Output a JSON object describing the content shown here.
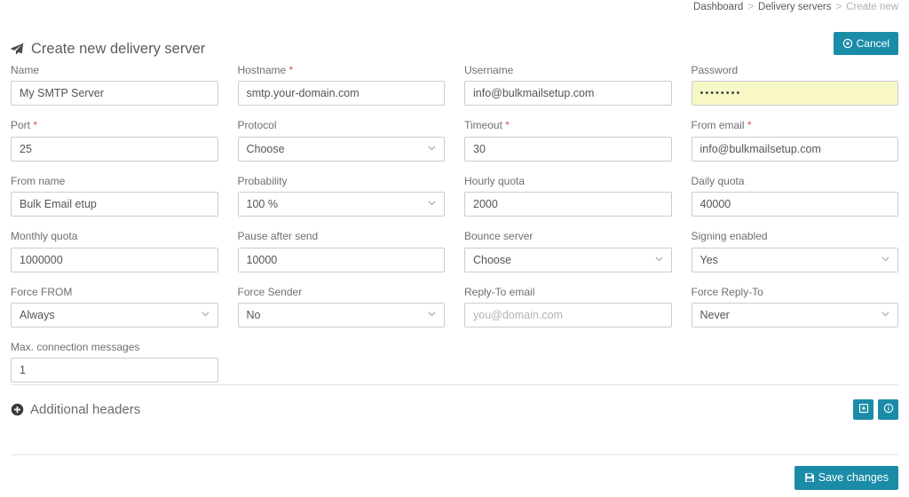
{
  "breadcrumb": {
    "items": [
      {
        "label": "Dashboard",
        "current": false
      },
      {
        "label": "Delivery servers",
        "current": false
      },
      {
        "label": "Create new",
        "current": true
      }
    ],
    "separator": ">"
  },
  "header": {
    "title": "Create new delivery server",
    "title_icon": "paper-plane-icon",
    "cancel_label": "Cancel",
    "cancel_icon": "ban-circle-icon"
  },
  "theme": {
    "accent": "#1b8ca8",
    "autofill_yellow": "#f7f8c6",
    "required_star": "#d9534f",
    "label_gray": "#6f6f6f",
    "border_gray": "#cccccc"
  },
  "form": {
    "fields": [
      {
        "label": "Name",
        "required": false,
        "type": "text",
        "value": "My SMTP Server",
        "placeholder": ""
      },
      {
        "label": "Hostname",
        "required": true,
        "type": "text",
        "value": "smtp.your-domain.com",
        "placeholder": ""
      },
      {
        "label": "Username",
        "required": false,
        "type": "text",
        "value": "info@bulkmailsetup.com",
        "placeholder": ""
      },
      {
        "label": "Password",
        "required": false,
        "type": "password",
        "value": "••••••••",
        "placeholder": "",
        "autofill": true
      },
      {
        "label": "Port",
        "required": true,
        "type": "text",
        "value": "25",
        "placeholder": ""
      },
      {
        "label": "Protocol",
        "required": false,
        "type": "select",
        "value": "Choose",
        "placeholder": ""
      },
      {
        "label": "Timeout",
        "required": true,
        "type": "text",
        "value": "30",
        "placeholder": ""
      },
      {
        "label": "From email",
        "required": true,
        "type": "text",
        "value": "info@bulkmailsetup.com",
        "placeholder": ""
      },
      {
        "label": "From name",
        "required": false,
        "type": "text",
        "value": "Bulk Email etup",
        "placeholder": ""
      },
      {
        "label": "Probability",
        "required": false,
        "type": "select",
        "value": "100 %",
        "placeholder": ""
      },
      {
        "label": "Hourly quota",
        "required": false,
        "type": "text",
        "value": "2000",
        "placeholder": ""
      },
      {
        "label": "Daily quota",
        "required": false,
        "type": "text",
        "value": "40000",
        "placeholder": ""
      },
      {
        "label": "Monthly quota",
        "required": false,
        "type": "text",
        "value": "1000000",
        "placeholder": ""
      },
      {
        "label": "Pause after send",
        "required": false,
        "type": "text",
        "value": "10000",
        "placeholder": ""
      },
      {
        "label": "Bounce server",
        "required": false,
        "type": "select",
        "value": "Choose",
        "placeholder": ""
      },
      {
        "label": "Signing enabled",
        "required": false,
        "type": "select",
        "value": "Yes",
        "placeholder": ""
      },
      {
        "label": "Force FROM",
        "required": false,
        "type": "select",
        "value": "Always",
        "placeholder": ""
      },
      {
        "label": "Force Sender",
        "required": false,
        "type": "select",
        "value": "No",
        "placeholder": ""
      },
      {
        "label": "Reply-To email",
        "required": false,
        "type": "text",
        "value": "",
        "placeholder": "you@domain.com"
      },
      {
        "label": "Force Reply-To",
        "required": false,
        "type": "select",
        "value": "Never",
        "placeholder": ""
      },
      {
        "label": "Max. connection messages",
        "required": false,
        "type": "text",
        "value": "1",
        "placeholder": ""
      }
    ]
  },
  "additional_headers": {
    "title": "Additional headers",
    "title_icon": "plus-circle-icon",
    "actions": [
      {
        "icon": "plus-square-icon",
        "name": "add-header-button"
      },
      {
        "icon": "info-circle-icon",
        "name": "header-info-button"
      }
    ]
  },
  "footer": {
    "save_label": "Save changes",
    "save_icon": "floppy-save-icon"
  }
}
